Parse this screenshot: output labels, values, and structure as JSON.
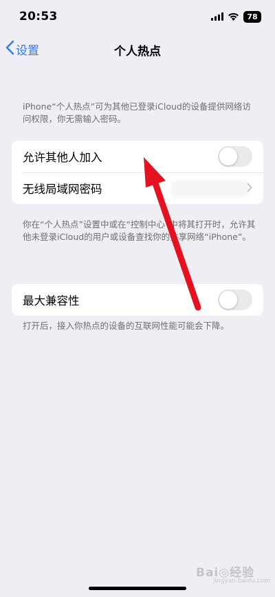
{
  "status": {
    "time": "20:53",
    "battery": "78",
    "icons": [
      "cellular-signal-icon",
      "wifi-icon",
      "battery-icon"
    ]
  },
  "nav": {
    "back_label": "设置",
    "title": "个人热点"
  },
  "intro_note": "iPhone“个人热点”可为其他已登录iCloud的设备提供网络访问权限，你无需输入密码。",
  "group1": {
    "allow_others_label": "允许其他人加入",
    "allow_others_on": false,
    "wifi_password_label": "无线局域网密码"
  },
  "group1_note": "你在“个人热点”设置中或在“控制中心”中将其打开时，允许其他未登录iCloud的用户或设备查找你的共享网络“iPhone”。",
  "group2": {
    "max_compat_label": "最大兼容性",
    "max_compat_on": false
  },
  "group2_note": "打开后，接入你热点的设备的互联网性能可能会下降。",
  "watermark": {
    "text": "Bai◎经验",
    "sub": "jingyan.baidu.com"
  },
  "colors": {
    "accent": "#2f7bf6",
    "background": "#efeef4",
    "annotation_arrow": "#e3121e"
  }
}
